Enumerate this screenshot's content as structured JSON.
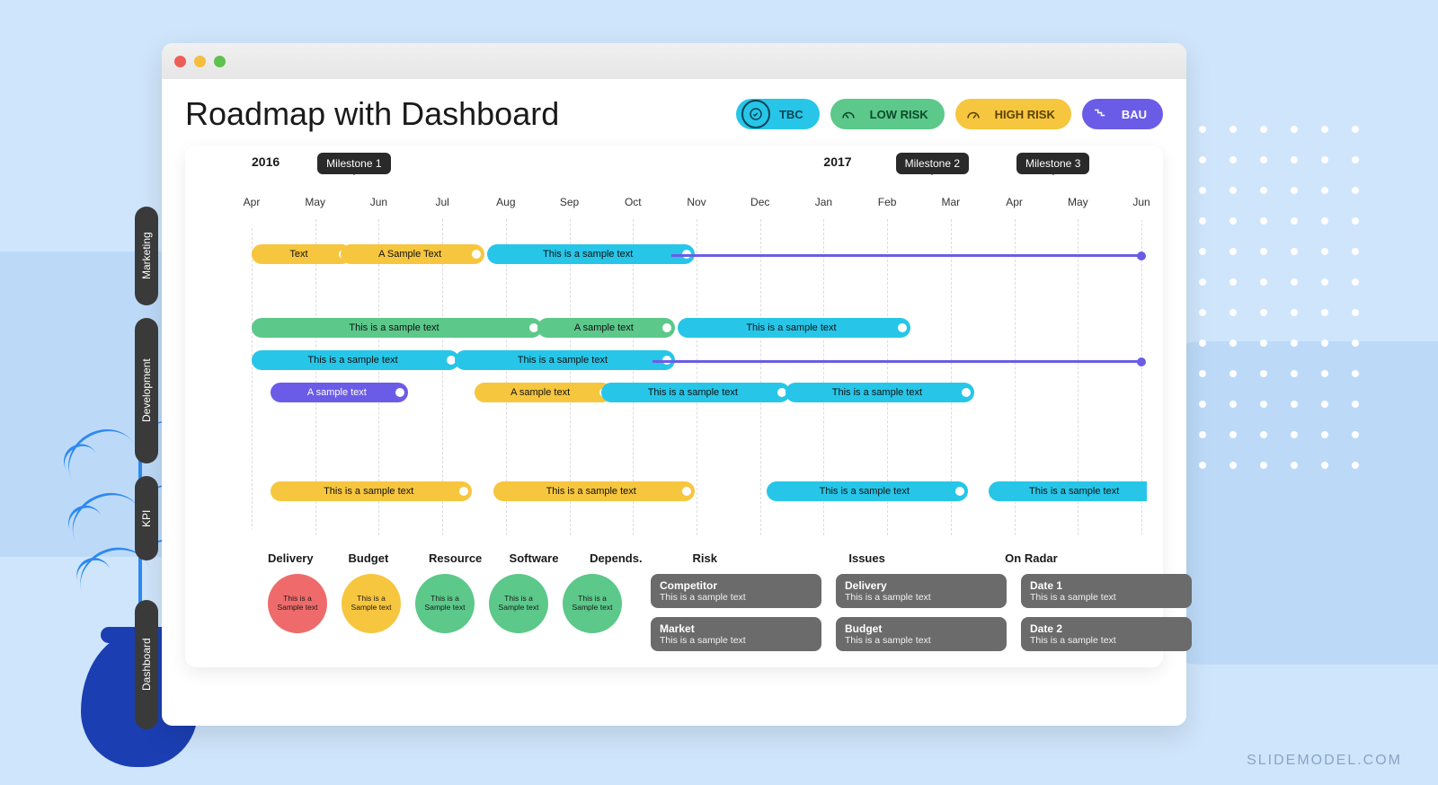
{
  "watermark": "SLIDEMODEL.COM",
  "title": "Roadmap with Dashboard",
  "legend": [
    {
      "label": "TBC",
      "color": "cyan",
      "icon": "check-badge"
    },
    {
      "label": "LOW RISK",
      "color": "green",
      "icon": "gauge-low"
    },
    {
      "label": "HIGH RISK",
      "color": "yellow",
      "icon": "gauge-high"
    },
    {
      "label": "BAU",
      "color": "purple",
      "icon": "steps"
    }
  ],
  "years": [
    {
      "label": "2016",
      "col": 0
    },
    {
      "label": "2017",
      "col": 9
    }
  ],
  "milestones": [
    {
      "label": "Milestone 1",
      "col": 1.6
    },
    {
      "label": "Milestone 2",
      "col": 10.7
    },
    {
      "label": "Milestone 3",
      "col": 12.6
    }
  ],
  "months": [
    "Apr",
    "May",
    "Jun",
    "Jul",
    "Aug",
    "Sep",
    "Oct",
    "Nov",
    "Dec",
    "Jan",
    "Feb",
    "Mar",
    "Apr",
    "May",
    "Jun"
  ],
  "tracks": [
    "Marketing",
    "Development",
    "KPI"
  ],
  "dash_label": "Dashboard",
  "chart_data": {
    "type": "bar",
    "title": "Roadmap with Dashboard",
    "x_unit": "month index (Apr 2016 = 0, Jun 2017 = 14)",
    "tracks": [
      {
        "name": "Marketing",
        "bars": [
          {
            "row": 0,
            "start": 0,
            "end": 1.2,
            "color": "yellow",
            "label": "Text"
          },
          {
            "row": 0,
            "start": 1.4,
            "end": 3.3,
            "color": "yellow",
            "label": "A Sample Text"
          },
          {
            "row": 0,
            "start": 3.7,
            "end": 6.6,
            "color": "cyan",
            "label": "This is a sample text"
          }
        ],
        "lines": [
          {
            "row": 0,
            "start": 6.6,
            "end": 14
          }
        ]
      },
      {
        "name": "Development",
        "bars": [
          {
            "row": 0,
            "start": 0,
            "end": 4.2,
            "color": "green",
            "label": "This is a sample text"
          },
          {
            "row": 0,
            "start": 4.5,
            "end": 6.3,
            "color": "green",
            "label": "A sample text"
          },
          {
            "row": 0,
            "start": 6.7,
            "end": 10.0,
            "color": "cyan",
            "label": "This is a sample text"
          },
          {
            "row": 1,
            "start": 0,
            "end": 2.9,
            "color": "cyan",
            "label": "This is a sample text"
          },
          {
            "row": 1,
            "start": 3.2,
            "end": 6.3,
            "color": "cyan",
            "label": "This is a sample text"
          },
          {
            "row": 2,
            "start": 0.3,
            "end": 2.1,
            "color": "purple",
            "label": "A sample text"
          },
          {
            "row": 2,
            "start": 3.5,
            "end": 5.3,
            "color": "yellow",
            "label": "A sample text"
          },
          {
            "row": 2,
            "start": 5.5,
            "end": 8.1,
            "color": "cyan",
            "label": "This is a sample text"
          },
          {
            "row": 2,
            "start": 8.4,
            "end": 11.0,
            "color": "cyan",
            "label": "This is a sample text"
          }
        ],
        "lines": [
          {
            "row": 1,
            "start": 6.3,
            "end": 14
          }
        ]
      },
      {
        "name": "KPI",
        "bars": [
          {
            "row": 0,
            "start": 0.3,
            "end": 3.1,
            "color": "yellow",
            "label": "This is a sample text"
          },
          {
            "row": 0,
            "start": 3.8,
            "end": 6.6,
            "color": "yellow",
            "label": "This is a sample text"
          },
          {
            "row": 0,
            "start": 8.1,
            "end": 10.9,
            "color": "cyan",
            "label": "This is a sample text"
          },
          {
            "row": 0,
            "start": 11.6,
            "end": 14.0,
            "color": "cyan",
            "label": "This is a sample text"
          }
        ],
        "lines": []
      }
    ]
  },
  "dashboard": {
    "stat_headers": [
      "Delivery",
      "Budget",
      "Resource",
      "Software",
      "Depends."
    ],
    "stats": [
      {
        "color": "red",
        "text": "This is a Sample text"
      },
      {
        "color": "yellow",
        "text": "This is a Sample text"
      },
      {
        "color": "green",
        "text": "This is a Sample text"
      },
      {
        "color": "green",
        "text": "This is a Sample text"
      },
      {
        "color": "green",
        "text": "This is a Sample text"
      }
    ],
    "list_headers": [
      "Risk",
      "Issues",
      "On Radar"
    ],
    "lists": [
      [
        {
          "title": "Competitor",
          "sub": "This is a sample text"
        },
        {
          "title": "Market",
          "sub": "This is a sample text"
        }
      ],
      [
        {
          "title": "Delivery",
          "sub": "This is a sample text"
        },
        {
          "title": "Budget",
          "sub": "This is a sample text"
        }
      ],
      [
        {
          "title": "Date 1",
          "sub": "This is a sample text"
        },
        {
          "title": "Date 2",
          "sub": "This is a sample text"
        }
      ]
    ]
  }
}
